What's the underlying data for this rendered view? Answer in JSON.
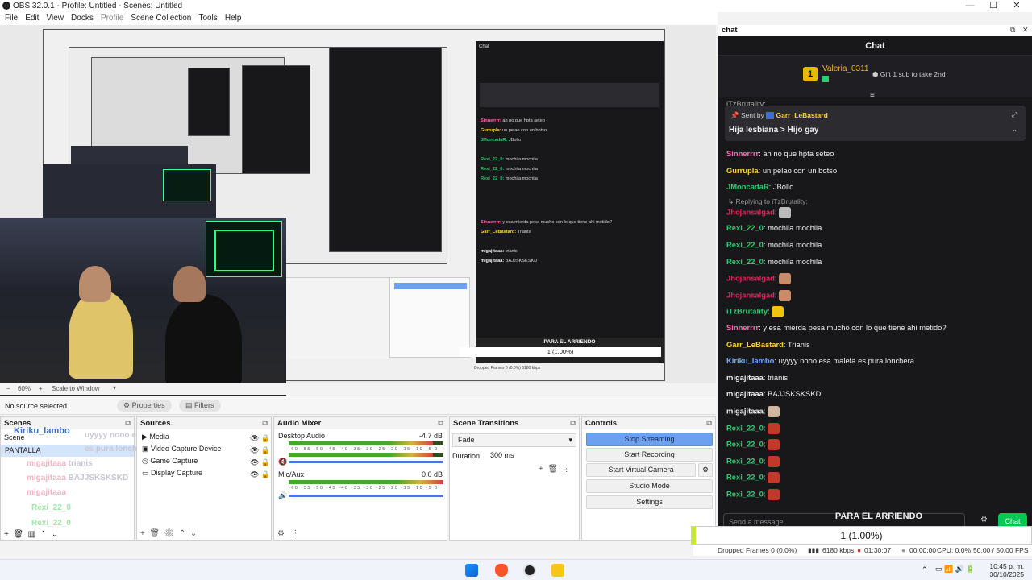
{
  "window": {
    "title": "OBS 32.0.1 - Profile: Untitled - Scenes: Untitled",
    "minimize": "—",
    "maximize": "☐",
    "close": "✕"
  },
  "menu": [
    "File",
    "Edit",
    "View",
    "Docks",
    "Profile",
    "Scene Collection",
    "Tools",
    "Help"
  ],
  "preview": {
    "zoom": "60%",
    "scale_mode": "Scale to Window",
    "mini_chat_title": "Chat",
    "mini_alert": "PARA EL ARRIENDO",
    "mini_progress": "1 (1.00%)",
    "mini_stats": "Dropped Frames 0 (0.0%)   6180 kbps"
  },
  "source_bar": {
    "no_source": "No source selected",
    "properties": "Properties",
    "filters": "Filters"
  },
  "scenes": {
    "title": "Scenes",
    "items": [
      "Scene",
      "PANTALLA"
    ]
  },
  "sources": {
    "title": "Sources",
    "items": [
      "Media",
      "Video Capture Device",
      "Game Capture",
      "Display Capture"
    ]
  },
  "mixer": {
    "title": "Audio Mixer",
    "channels": [
      {
        "name": "Desktop Audio",
        "db": "-4.7 dB",
        "level": 0.93
      },
      {
        "name": "Mic/Aux",
        "db": "0.0 dB",
        "level": 1.0
      }
    ],
    "scale": "-60 -55 -50 -45 -40 -35 -30 -25 -20 -15 -10 -5 0"
  },
  "transitions": {
    "title": "Scene Transitions",
    "selected": "Fade",
    "duration_label": "Duration",
    "duration_value": "300 ms"
  },
  "controls": {
    "title": "Controls",
    "buttons": [
      "Stop Streaming",
      "Start Recording",
      "Start Virtual Camera",
      "Studio Mode",
      "Settings"
    ]
  },
  "chat": {
    "dock_title": "chat",
    "header": "Chat",
    "hype_user": "Valeria_0311",
    "hype_count": "1",
    "hype_gift": "Gift 1 sub to take 2nd",
    "pinned_by_prefix": "Sent by",
    "pinned_by_user": "Garr_LeBastard",
    "pinned_text": "Hija lesbiana > Hijo gay",
    "partial_user": "iTzBrutality:",
    "replying": "Replying to iTzBrutality:",
    "messages": [
      {
        "user": "Sinnerrrr",
        "text": "ah no que hpta seteo",
        "color": "#ff69b4",
        "emote": ""
      },
      {
        "user": "Gurrupla",
        "text": "un pelao con un botso",
        "color": "#ffd23f",
        "emote": ""
      },
      {
        "user": "JMoncadaR",
        "text": "JBollo",
        "color": "#2ecc71",
        "emote": ""
      },
      {
        "user": "Jhojansalgad",
        "text": "",
        "color": "#e0245e",
        "emote": "gray"
      },
      {
        "user": "Rexi_22_0",
        "text": "mochila mochila",
        "color": "#2ecc71",
        "emote": ""
      },
      {
        "user": "Rexi_22_0",
        "text": "mochila mochila",
        "color": "#2ecc71",
        "emote": ""
      },
      {
        "user": "Rexi_22_0",
        "text": "mochila mochila",
        "color": "#2ecc71",
        "emote": ""
      },
      {
        "user": "Jhojansalgad",
        "text": "",
        "color": "#e0245e",
        "emote": "face"
      },
      {
        "user": "Jhojansalgad",
        "text": "",
        "color": "#e0245e",
        "emote": "face"
      },
      {
        "user": "iTzBrutality",
        "text": "",
        "color": "#2ecc71",
        "emote": "yellow"
      },
      {
        "user": "Sinnerrrr",
        "text": "y esa mierda pesa mucho con lo que tiene ahi metido?",
        "color": "#ff69b4",
        "emote": ""
      },
      {
        "user": "Garr_LeBastard",
        "text": "Trianis",
        "color": "#ffd23f",
        "emote": ""
      },
      {
        "user": "Kiriku_lambo",
        "text": "uyyyy nooo esa maleta es pura lonchera",
        "color": "#6fa8ff",
        "emote": ""
      },
      {
        "user": "migajitaaa",
        "text": "trianis",
        "color": "#efeff1",
        "emote": ""
      },
      {
        "user": "migajitaaa",
        "text": "BAJJSKSKSKD",
        "color": "#efeff1",
        "emote": ""
      },
      {
        "user": "migajitaaa",
        "text": "",
        "color": "#efeff1",
        "emote": "photo"
      },
      {
        "user": "Rexi_22_0",
        "text": "",
        "color": "#2ecc71",
        "emote": "red"
      },
      {
        "user": "Rexi_22_0",
        "text": "",
        "color": "#2ecc71",
        "emote": "red"
      },
      {
        "user": "Rexi_22_0",
        "text": "",
        "color": "#2ecc71",
        "emote": "red"
      },
      {
        "user": "Rexi_22_0",
        "text": "",
        "color": "#2ecc71",
        "emote": "red"
      },
      {
        "user": "Rexi_22_0",
        "text": "",
        "color": "#2ecc71",
        "emote": "red"
      }
    ],
    "placeholder": "Send a message",
    "chat_button": "Chat"
  },
  "overlay": {
    "alert_title": "PARA EL ARRIENDO",
    "progress_text": "1 (1.00%)",
    "progress_value": 0.01,
    "ghost_user": "Kiriku_lambo",
    "ghost_text": "uyyyy nooo esa maleta es pura lonchera"
  },
  "status": {
    "dropped": "Dropped Frames 0 (0.0%)",
    "kbps": "6180 kbps",
    "live_time": "01:30:07",
    "rec_time": "00:00:00",
    "cpu": "CPU: 0.0%",
    "fps": "50.00 / 50.00 FPS"
  },
  "tray": {
    "time": "10:45 p. m.",
    "date": "30/10/2025"
  },
  "colors": {
    "accent": "#6ea0f0",
    "chat_bg": "#18181b",
    "twitch_purple": "#9147ff",
    "chat_send": "#00c853"
  }
}
